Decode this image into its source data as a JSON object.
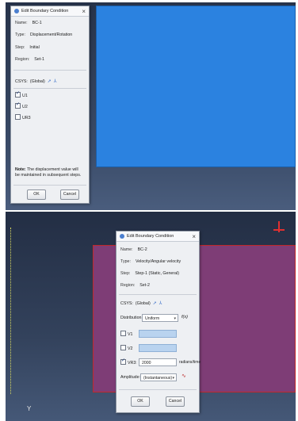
{
  "dialog1": {
    "title": "Edit Boundary Condition",
    "name_label": "Name:",
    "name_value": "BC-1",
    "type_label": "Type:",
    "type_value": "Displacement/Rotation",
    "step_label": "Step:",
    "step_value": "Initial",
    "region_label": "Region:",
    "region_value": "Set-1",
    "csys_label": "CSYS:",
    "csys_value": "(Global)",
    "dofs": [
      {
        "label": "U1",
        "checked": true
      },
      {
        "label": "U2",
        "checked": true
      },
      {
        "label": "UR3",
        "checked": false
      }
    ],
    "note_label": "Note:",
    "note_text": "The displacement value will be maintained in subsequent steps.",
    "ok_label": "OK",
    "cancel_label": "Cancel"
  },
  "dialog2": {
    "title": "Edit Boundary Condition",
    "name_label": "Name:",
    "name_value": "BC-2",
    "type_label": "Type:",
    "type_value": "Velocity/Angular velocity",
    "step_label": "Step:",
    "step_value": "Step-1 (Static, General)",
    "region_label": "Region:",
    "region_value": "Set-2",
    "csys_label": "CSYS:",
    "csys_value": "(Global)",
    "distribution_label": "Distribution:",
    "distribution_value": "Uniform",
    "fx_label": "f(x)",
    "dofs": [
      {
        "label": "V1",
        "checked": false,
        "value": ""
      },
      {
        "label": "V2",
        "checked": false,
        "value": ""
      },
      {
        "label": "VR3:",
        "checked": true,
        "value": "2000"
      }
    ],
    "units_label": "radians/time",
    "amplitude_label": "Amplitude:",
    "amplitude_value": "(Instantaneous)",
    "ok_label": "OK",
    "cancel_label": "Cancel"
  },
  "viewport_axis_label": "Y",
  "colors": {
    "viewport_bg": "#2f3c55",
    "part_top": "#2b82e0",
    "part_bottom": "#7e3d76",
    "edge_highlight": "#c02929",
    "dialog_bg": "#eef0f3"
  },
  "icons": [
    "select-arrow-icon",
    "create-csys-icon",
    "close-icon",
    "dropdown-arrow-icon",
    "amplitude-create-icon"
  ]
}
